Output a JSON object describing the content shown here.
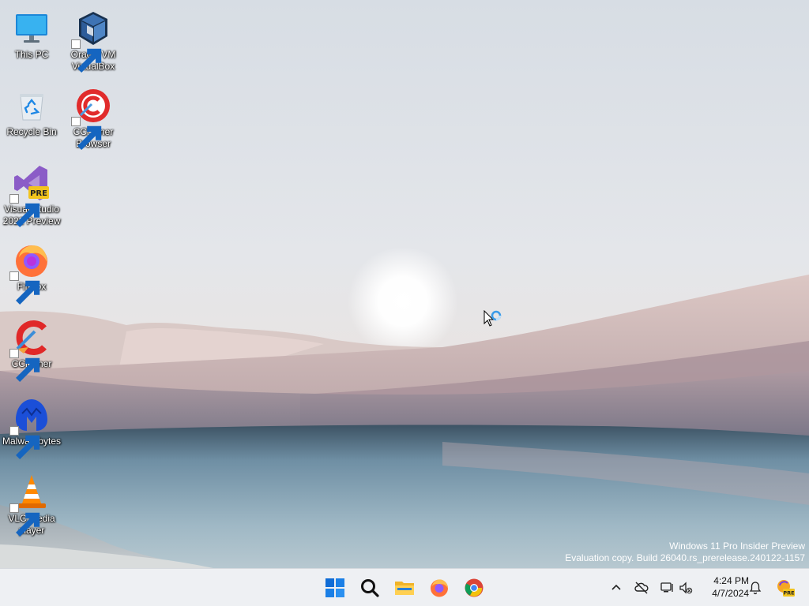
{
  "desktop": {
    "icons": [
      {
        "label": "This PC"
      },
      {
        "label": "Oracle VM VirtualBox"
      },
      {
        "label": "Recycle Bin"
      },
      {
        "label": "CCleaner Browser"
      },
      {
        "label": "Visual Studio 2022 Preview"
      },
      {
        "label": "Firefox"
      },
      {
        "label": "CCleaner"
      },
      {
        "label": "Malwarebytes"
      },
      {
        "label": "VLC media player"
      }
    ]
  },
  "watermark": {
    "line1": "Windows 11 Pro Insider Preview",
    "line2": "Evaluation copy. Build 26040.rs_prerelease.240122-1157"
  },
  "taskbar": {
    "apps": [
      {
        "icon": "windows-start-icon"
      },
      {
        "icon": "search-icon"
      },
      {
        "icon": "file-explorer-icon"
      },
      {
        "icon": "firefox-icon"
      },
      {
        "icon": "chrome-icon"
      }
    ],
    "tray": {
      "icons": [
        "chevron-up-icon",
        "onedrive-offline-icon",
        "network-icon",
        "volume-muted-icon",
        "notification-bell-icon",
        "copilot-pre-icon"
      ],
      "time": "4:24 PM",
      "date": "4/7/2024"
    }
  },
  "colors": {
    "sky": "#dfe4ea",
    "taskbar": "#eef0f3",
    "start_blue": "#0f6cd6"
  }
}
